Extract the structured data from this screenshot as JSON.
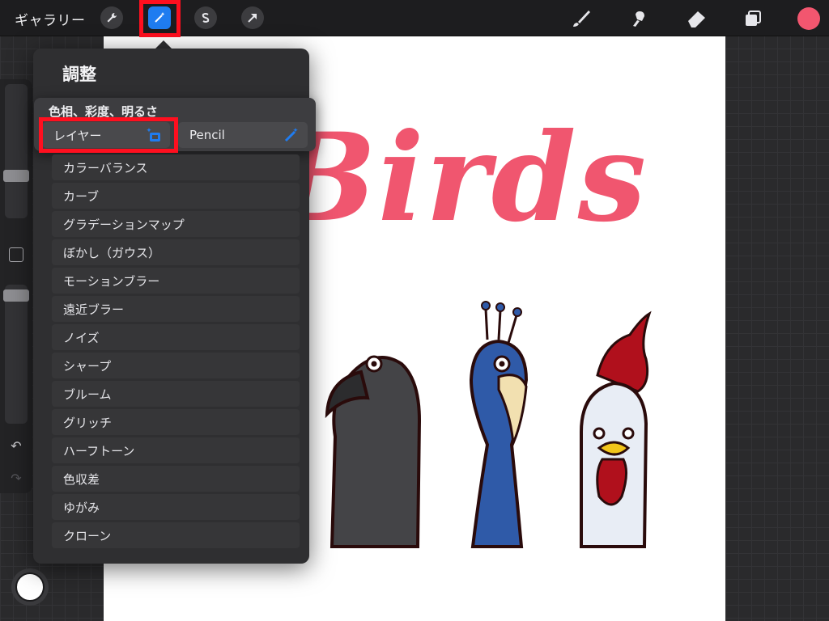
{
  "topbar": {
    "gallery_label": "ギャラリー",
    "tools_left": [
      "wrench-icon",
      "magic-wand-icon",
      "selection-s-icon",
      "transform-arrow-icon"
    ],
    "tools_right": [
      "brush-icon",
      "smudge-icon",
      "eraser-icon",
      "layers-icon"
    ],
    "current_color": "#f2566f"
  },
  "panel": {
    "title": "調整"
  },
  "submenu": {
    "title": "色相、彩度、明るさ",
    "option_layer": "レイヤー",
    "option_pencil": "Pencil"
  },
  "menu": {
    "items": [
      "カラーバランス",
      "カーブ",
      "グラデーションマップ",
      "ぼかし（ガウス）",
      "モーションブラー",
      "遠近ブラー",
      "ノイズ",
      "シャープ",
      "ブルーム",
      "グリッチ",
      "ハーフトーン",
      "色収差",
      "ゆがみ",
      "クローン"
    ]
  },
  "canvas": {
    "title_text": "Birds"
  },
  "colors": {
    "accent_blue": "#1f7cf0",
    "highlight_red": "#ff0f1f",
    "title_pink": "#f0566f"
  }
}
